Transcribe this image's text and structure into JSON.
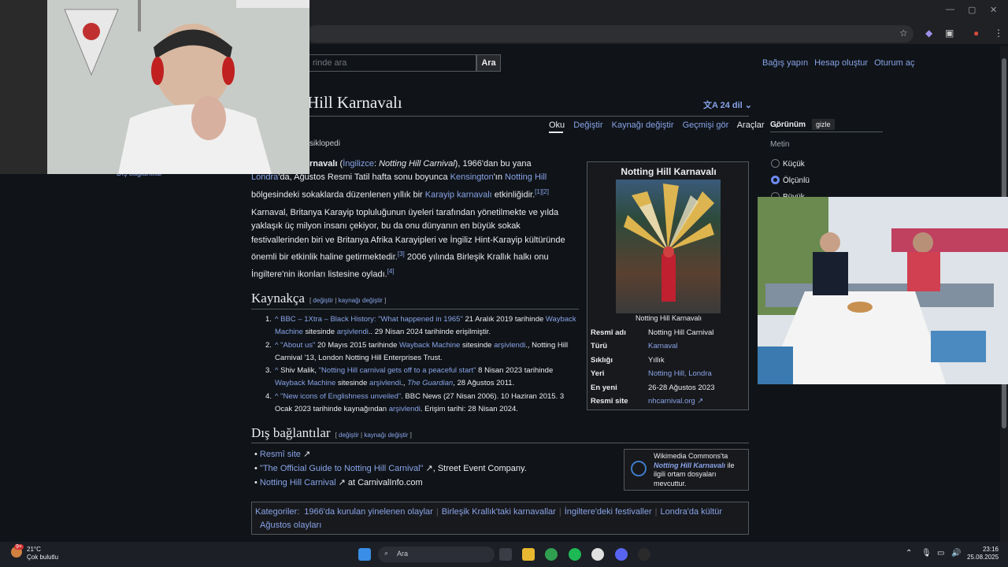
{
  "browser": {
    "controls": {
      "minimize": "—",
      "restore": "▢",
      "close": "✕"
    },
    "toolbar_icons": [
      "star-icon",
      "extension-icon",
      "puzzle-icon",
      "profile-icon",
      "menu-icon"
    ]
  },
  "header": {
    "search_placeholder": "rinde ara",
    "search_button": "Ara",
    "user_links": [
      "Bağış yapın",
      "Hesap oluştur",
      "Oturum aç"
    ]
  },
  "article": {
    "title": "Hill Karnavalı",
    "languages": "24 dil",
    "tabs": [
      "Oku",
      "Değiştir",
      "Kaynağı değiştir",
      "Geçmişi gör"
    ],
    "tools": "Araçlar",
    "tagline": "siklopedi",
    "side_link": "Dış bağlantılar",
    "p1": {
      "a": "rnavalı",
      "b": " (",
      "c": "İngilizce",
      "d": ": ",
      "e": "Notting Hill Carnival",
      "f": "), 1966'dan bu yana ",
      "g": "Londra",
      "h": "'da, Ağustos Resmi Tatil hafta sonu boyunca ",
      "i": "Kensington",
      "j": "'ın ",
      "k": "Notting Hill",
      "l": " bölgesindeki sokaklarda düzenlenen yıllık bir ",
      "m": "Karayip karnavalı",
      "n": " etkinliğidir.",
      "sup": "[1][2]"
    },
    "p2": {
      "text": "Karnaval, Britanya Karayip topluluğunun üyeleri tarafından yönetilmekte ve yılda yaklaşık üç milyon insanı çekiyor, bu da onu dünyanın en büyük sokak festivallerinden biri ve Britanya Afrika Karayipleri ve İngiliz Hint-Karayip kültüründe önemli bir etkinlik haline getirmektedir.",
      "sup1": "[3]",
      "text2": " 2006 yılında Birleşik Krallık halkı onu İngiltere'nin ikonları listesine oyladı.",
      "sup2": "[4]"
    }
  },
  "sections": {
    "refs_title": "Kaynakça",
    "ext_title": "Dış bağlantılar",
    "edit_open": "[ ",
    "edit1": "değiştir",
    "edit_sep": " | ",
    "edit2": "kaynağı değiştir",
    "edit_close": " ]"
  },
  "references": [
    {
      "num": "1.",
      "caret": "^",
      "link": "BBC – 1Xtra – Black History: \"What happened in 1965\"",
      "t1": " 21 Aralık 2019 tarihinde ",
      "link2": "Wayback Machine",
      "t2": " sitesinde ",
      "link3": "arşivlendi",
      "t3": ".. 29 Nisan 2024 tarihinde erişilmiştir."
    },
    {
      "num": "2.",
      "caret": "^",
      "link": "\"About us\"",
      "t1": " 20 Mayıs 2015 tarihinde ",
      "link2": "Wayback Machine",
      "t2": " sitesinde ",
      "link3": "arşivlendi",
      "t3": "., Notting Hill Carnival '13, London Notting Hill Enterprises Trust."
    },
    {
      "num": "3.",
      "caret": "^",
      "link": "\"Notting Hill carnival gets off to a peaceful start\"",
      "t0": "Shiv Malik, ",
      "t1": " 8 Nisan 2023 tarihinde ",
      "link2": "Wayback Machine",
      "t2": " sitesinde ",
      "link3": "arşivlendi",
      "t3": "., ",
      "link4": "The Guardian",
      "t4": ", 28 Ağustos 2011."
    },
    {
      "num": "4.",
      "caret": "^",
      "link": "\"New icons of Englishness unveiled\"",
      "t1": ". BBC News (27 Nisan 2006). 10 Haziran 2015. 3 Ocak 2023 tarihinde kaynağından ",
      "link3": "arşivlendi",
      "t3": ". Erişim tarihi: 28 Nisan 2024."
    }
  ],
  "external_links": [
    {
      "link": "Resmî site",
      "text": ""
    },
    {
      "link": "\"The Official Guide to Notting Hill Carnival\"",
      "text": ", Street Event Company."
    },
    {
      "link": "Notting Hill Carnival",
      "text": " at CarnivalInfo.com"
    }
  ],
  "infobox": {
    "title": "Notting Hill Karnavalı",
    "caption": "Notting Hill Karnavalı",
    "rows": [
      {
        "key": "Resmî adı",
        "value": "Notting Hill Carnival"
      },
      {
        "key": "Türü",
        "value": "Karnaval"
      },
      {
        "key": "Sıklığı",
        "value": "Yıllık"
      },
      {
        "key": "Yeri",
        "value": "Notting Hill, Londra"
      },
      {
        "key": "En yeni",
        "value": "26-28 Ağustos 2023"
      },
      {
        "key": "Resmî site",
        "value": "nhcarnival.org"
      }
    ]
  },
  "commons": {
    "t1": "Wikimedia Commons'ta",
    "link": "Notting Hill Karnavalı",
    "t2": " ile ilgili ortam dosyaları mevcuttur."
  },
  "categories": {
    "label": "Kategoriler:",
    "items": [
      "1966'da kurulan yinelenen olaylar",
      "Birleşik Krallık'taki karnavallar",
      "İngiltere'deki festivaller",
      "Londra'da kültür",
      "Ağustos olayları"
    ]
  },
  "appearance": {
    "title": "Görünüm",
    "hide": "gizle",
    "text_label": "Metin",
    "options": [
      "Küçük",
      "Ölçünlü",
      "Büyük"
    ],
    "selected": "Ölçünlü"
  },
  "taskbar": {
    "temp": "21°C",
    "weather": "Çok bulutlu",
    "search": "Ara",
    "time": "23:16",
    "date": "25.08.2025",
    "badge": "9+"
  },
  "colors": {
    "link": "#88a3e8",
    "bg": "#101418",
    "text": "#eaecf0"
  }
}
